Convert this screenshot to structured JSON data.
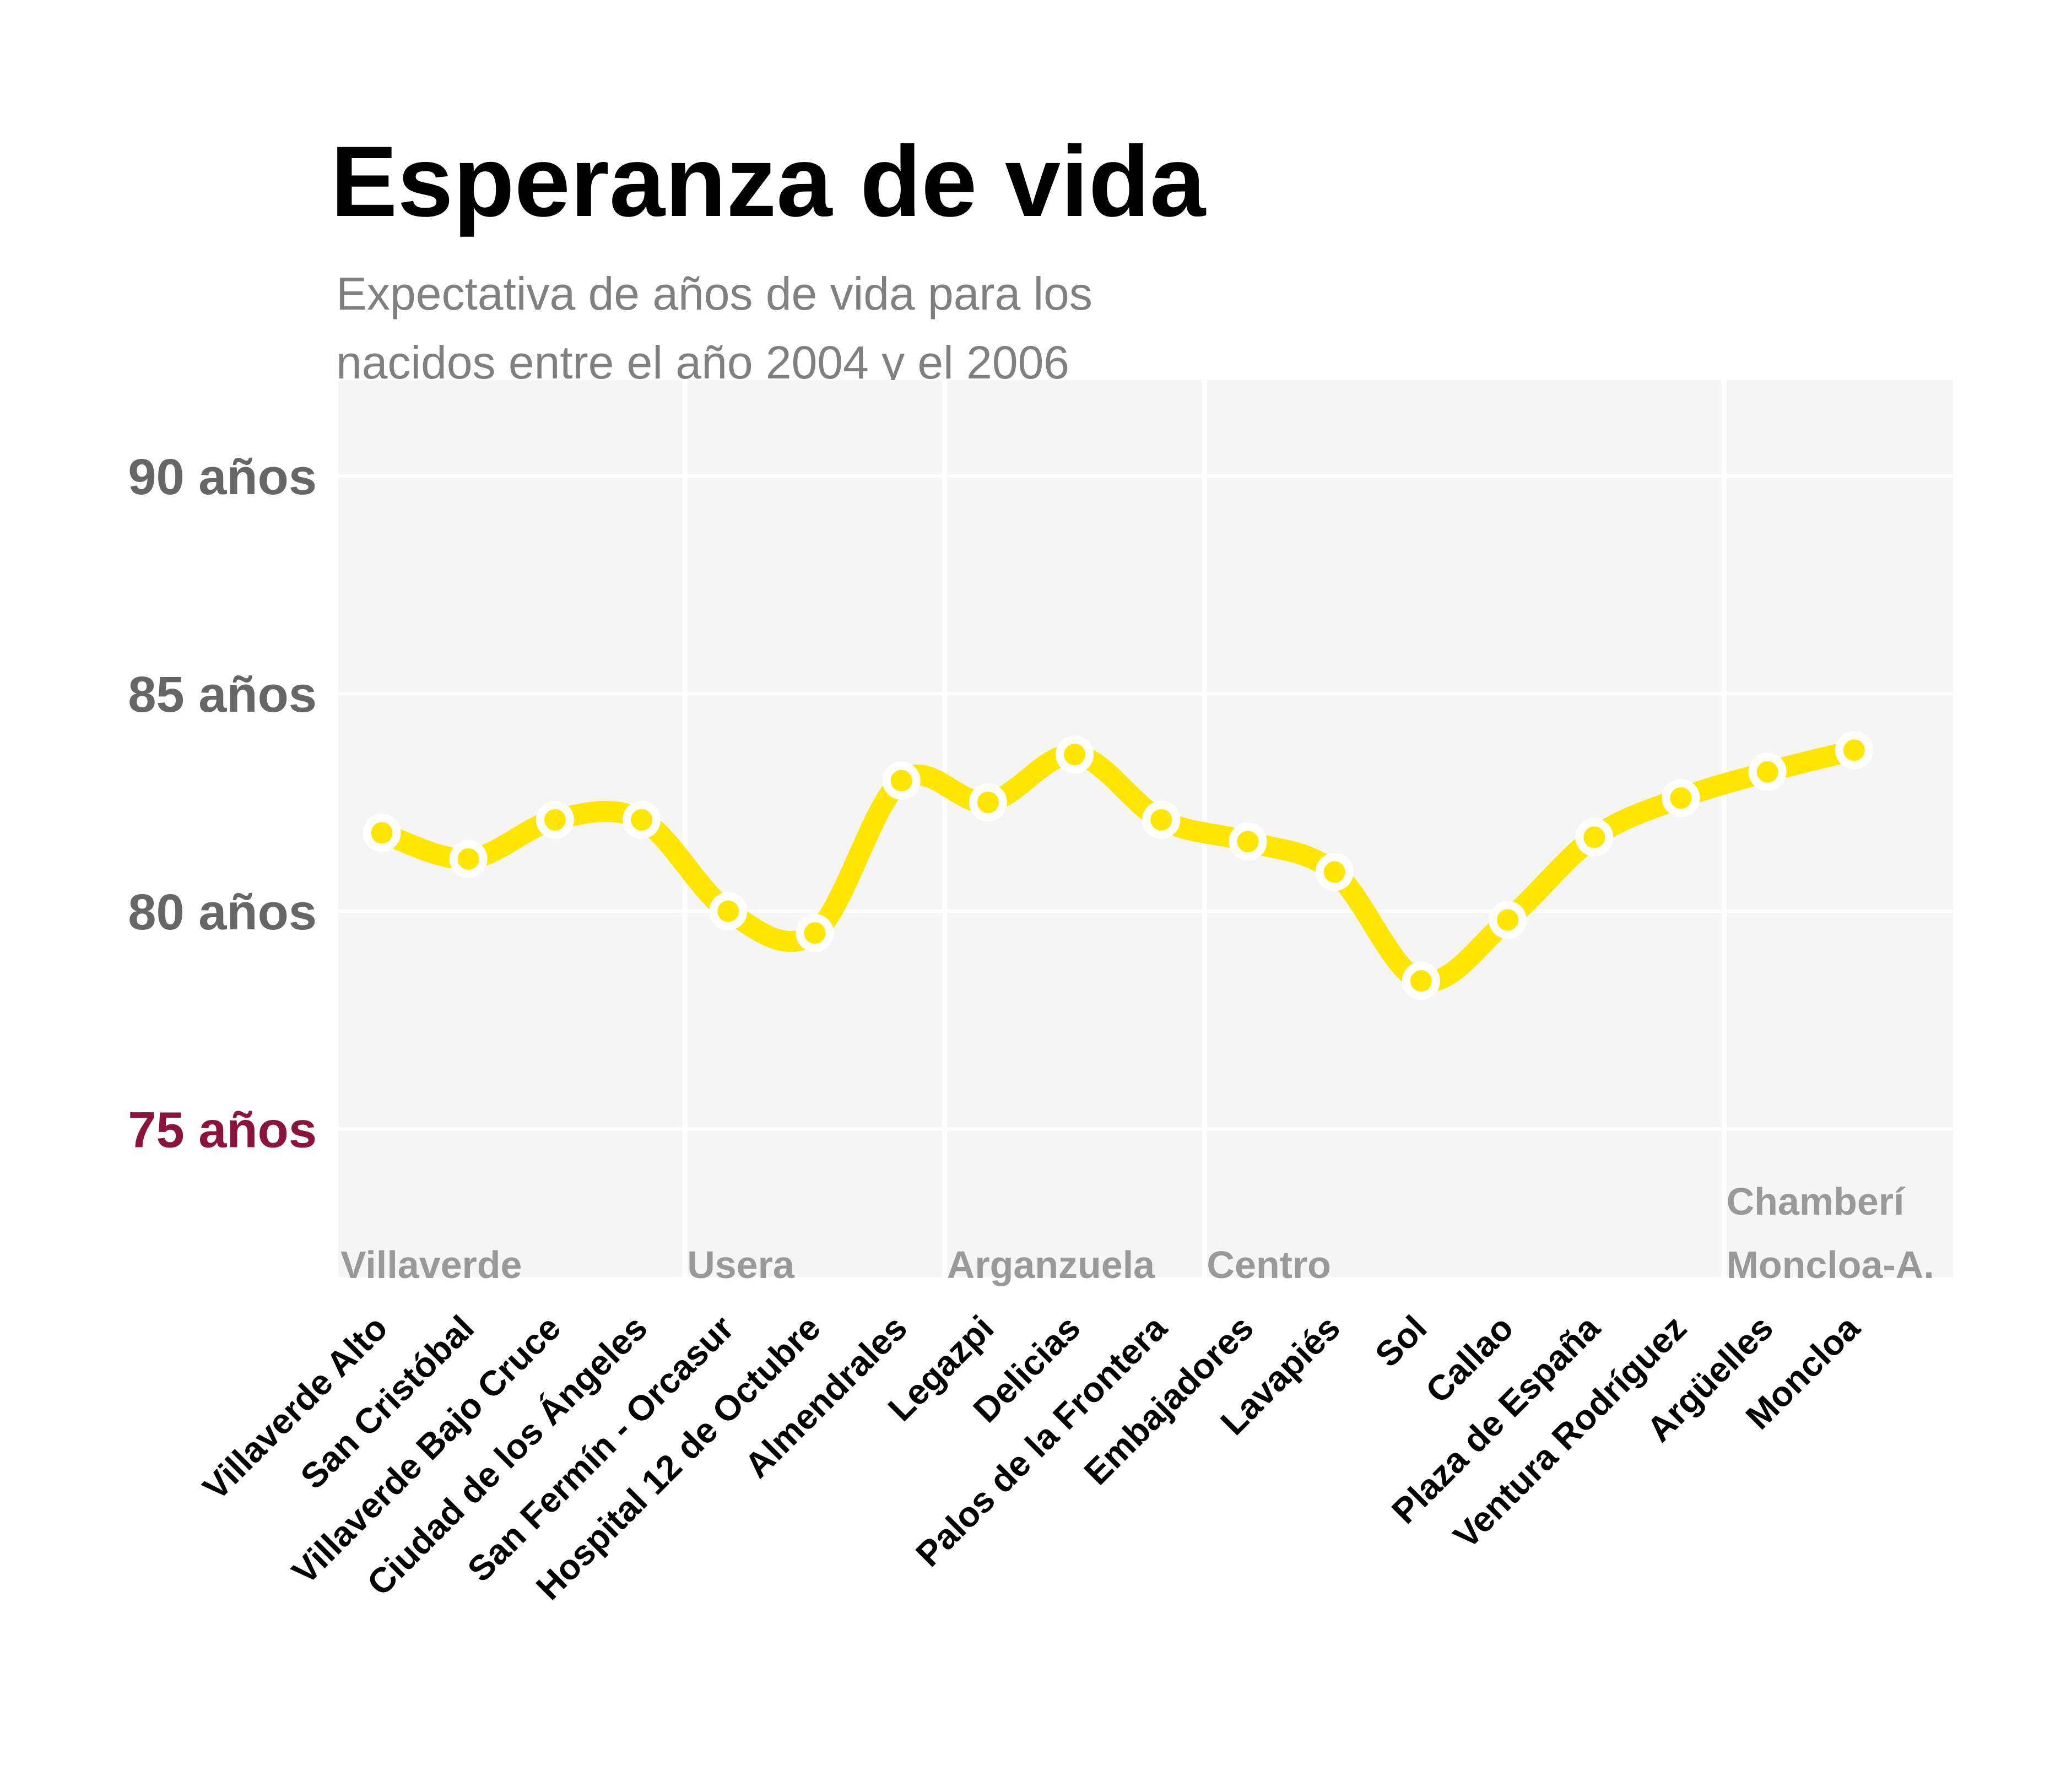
{
  "chart_data": {
    "type": "line",
    "title": "Esperanza de vida",
    "subtitle_lines": [
      "Expectativa de años de vida para los",
      "nacidos entre el año 2004 y el 2006"
    ],
    "xlabel": "",
    "ylabel": "",
    "ylim": [
      71.6,
      92.2
    ],
    "y_ticks": [
      {
        "value": 90,
        "label": "90 años"
      },
      {
        "value": 85,
        "label": "85 años"
      },
      {
        "value": 80,
        "label": "80 años"
      },
      {
        "value": 75,
        "label": "75 años"
      }
    ],
    "grid": true,
    "categories": [
      "Villaverde Alto",
      "San Cristóbal",
      "Villaverde Bajo Cruce",
      "Ciudad de los Ángeles",
      "San Fermín - Orcasur",
      "Hospital 12 de Octubre",
      "Almendrales",
      "Legazpi",
      "Delicias",
      "Palos de la Frontera",
      "Embajadores",
      "Lavapiés",
      "Sol",
      "Callao",
      "Plaza de España",
      "Ventura Rodríguez",
      "Argüelles",
      "Moncloa"
    ],
    "series": [
      {
        "values": [
          81.8,
          81.2,
          82.1,
          82.1,
          80.0,
          79.5,
          83.0,
          82.5,
          83.6,
          82.1,
          81.6,
          80.9,
          78.4,
          79.8,
          81.7,
          82.6,
          83.2,
          83.7
        ]
      }
    ],
    "groups": [
      {
        "label_lines": [
          "Villaverde"
        ],
        "start_index": 0,
        "end_index": 3
      },
      {
        "label_lines": [
          "Usera"
        ],
        "start_index": 4,
        "end_index": 6
      },
      {
        "label_lines": [
          "Arganzuela"
        ],
        "start_index": 7,
        "end_index": 9
      },
      {
        "label_lines": [
          "Centro"
        ],
        "start_index": 10,
        "end_index": 15
      },
      {
        "label_lines": [
          "Chamberí",
          "Moncloa-A."
        ],
        "start_index": 16,
        "end_index": 17
      }
    ],
    "colors": {
      "line": "#FFE600",
      "marker_fill": "#FFE600",
      "marker_stroke": "#FFFFFF",
      "panel": "#F5F5F5",
      "grid": "#FFFFFF",
      "title": "#000000",
      "subtitle": "#808080",
      "tick_label": "#666666",
      "highlight_tick_label": "#8C1339",
      "group_label": "#999999",
      "category_label": "#000000"
    },
    "highlight_tick_value": 75
  }
}
